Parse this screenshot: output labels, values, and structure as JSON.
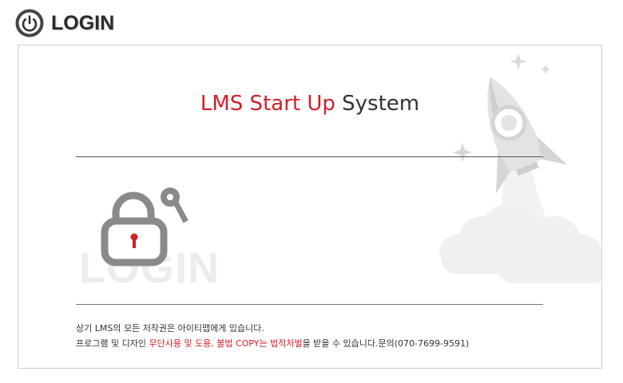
{
  "header": {
    "title": "LOGIN",
    "icon": "power-icon"
  },
  "panel": {
    "title_red": "LMS Start Up",
    "title_dark": "System",
    "watermark": "LOGIN",
    "lock_icon": "lock-with-key-icon",
    "decoration": "rocket-illustration"
  },
  "footer": {
    "line1": "상기 LMS의 모든 저작권은 아이티맵에게 있습니다.",
    "line2_start": "프로그램 및 디자인 ",
    "line2_red": "무단사용 및 도용, 불법 COPY는 법적처벌",
    "line2_end": "을 받을 수 있습니다.문의(070-7699-9591)"
  },
  "colors": {
    "accent": "#d31f2a",
    "text": "#333333",
    "border": "#cfcfcf"
  }
}
